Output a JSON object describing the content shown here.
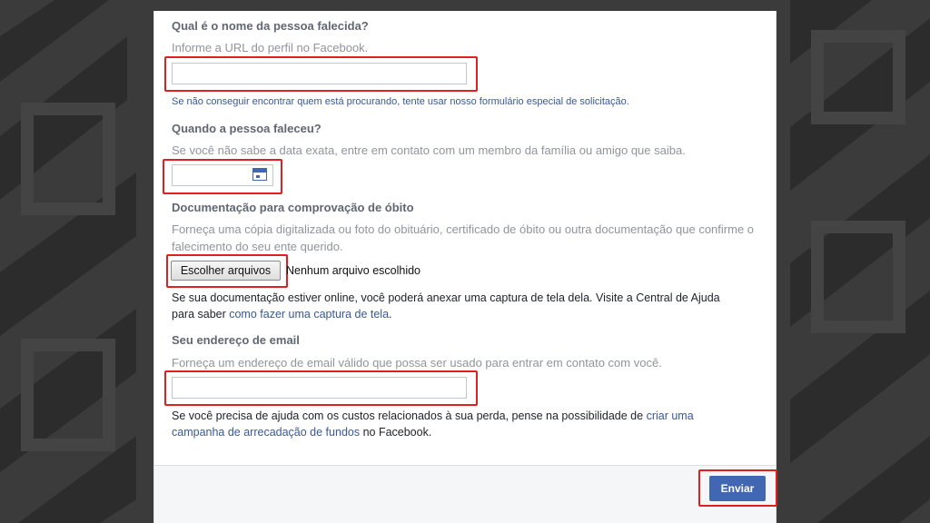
{
  "form": {
    "name_label": "Qual é o nome da pessoa falecida?",
    "name_hint": "Informe a URL do perfil no Facebook.",
    "name_value": "",
    "name_help": "Se não conseguir encontrar quem está procurando, tente usar nosso formulário especial de solicitação.",
    "date_label": "Quando a pessoa faleceu?",
    "date_hint": "Se você não sabe a data exata, entre em contato com um membro da família ou amigo que saiba.",
    "date_value": "",
    "doc_label": "Documentação para comprovação de óbito",
    "doc_hint_line1": "Forneça uma cópia digitalizada ou foto do obituário, certificado de óbito ou outra documentação que confirme o",
    "doc_hint_line2": "falecimento do seu ente querido.",
    "file_button": "Escolher arquivos",
    "file_status": "Nenhum arquivo escolhido",
    "doc_info_line1": "Se sua documentação estiver online, você poderá anexar uma captura de tela dela. Visite a Central de Ajuda",
    "doc_info_line2_prefix": "para saber ",
    "doc_info_link": "como fazer uma captura de tela",
    "doc_info_line2_suffix": ".",
    "email_label": "Seu endereço de email",
    "email_hint": "Forneça um endereço de email válido que possa ser usado para entrar em contato com você.",
    "email_value": "",
    "fund_line1_prefix": "Se você precisa de ajuda com os custos relacionados à sua perda, pense na possibilidade de ",
    "fund_link_part1": "criar uma",
    "fund_link_part2": "campanha de arrecadação de fundos",
    "fund_line2_suffix": " no Facebook."
  },
  "footer": {
    "submit_label": "Enviar"
  },
  "colors": {
    "accent": "#4267b2",
    "link": "#385898",
    "highlight": "#e02020"
  }
}
